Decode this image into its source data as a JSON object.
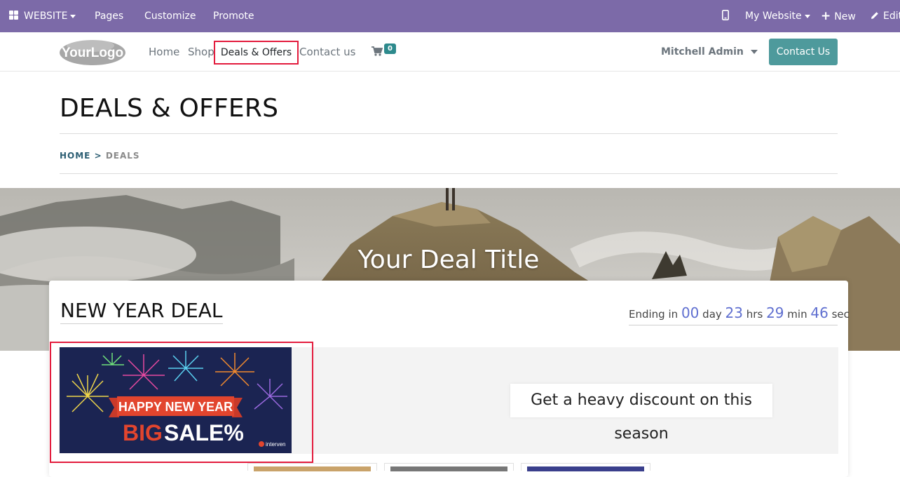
{
  "admin_bar": {
    "website_label": "WEBSITE",
    "pages": "Pages",
    "customize": "Customize",
    "promote": "Promote",
    "my_website": "My Website",
    "new": "New",
    "edit": "Edit"
  },
  "navbar": {
    "logo_text": "YourLogo",
    "items": [
      "Home",
      "Shop",
      "Deals & Offers",
      "Contact us"
    ],
    "cart_count": "0",
    "user": "Mitchell Admin",
    "contact_button": "Contact Us"
  },
  "page": {
    "title": "DEALS & OFFERS",
    "breadcrumb": {
      "home": "HOME",
      "separator": ">",
      "current": "DEALS"
    }
  },
  "hero": {
    "title": "Your Deal Title"
  },
  "deal": {
    "title": "NEW YEAR DEAL",
    "countdown": {
      "prefix": "Ending in",
      "days": "00",
      "days_unit": "day",
      "hours": "23",
      "hours_unit": "hrs",
      "minutes": "29",
      "minutes_unit": "min",
      "seconds": "46",
      "seconds_unit": "sec"
    },
    "banner": {
      "line1": "HAPPY NEW YEAR",
      "line2a": "BIG",
      "line2b": "SALE%",
      "brand": "interven"
    },
    "discount_text": "Get a heavy discount on this season"
  },
  "colors": {
    "admin_bar": "#7c6aa8",
    "accent": "#4e9a9c",
    "highlight": "#e31c3d",
    "countdown": "#5f6fd0"
  }
}
